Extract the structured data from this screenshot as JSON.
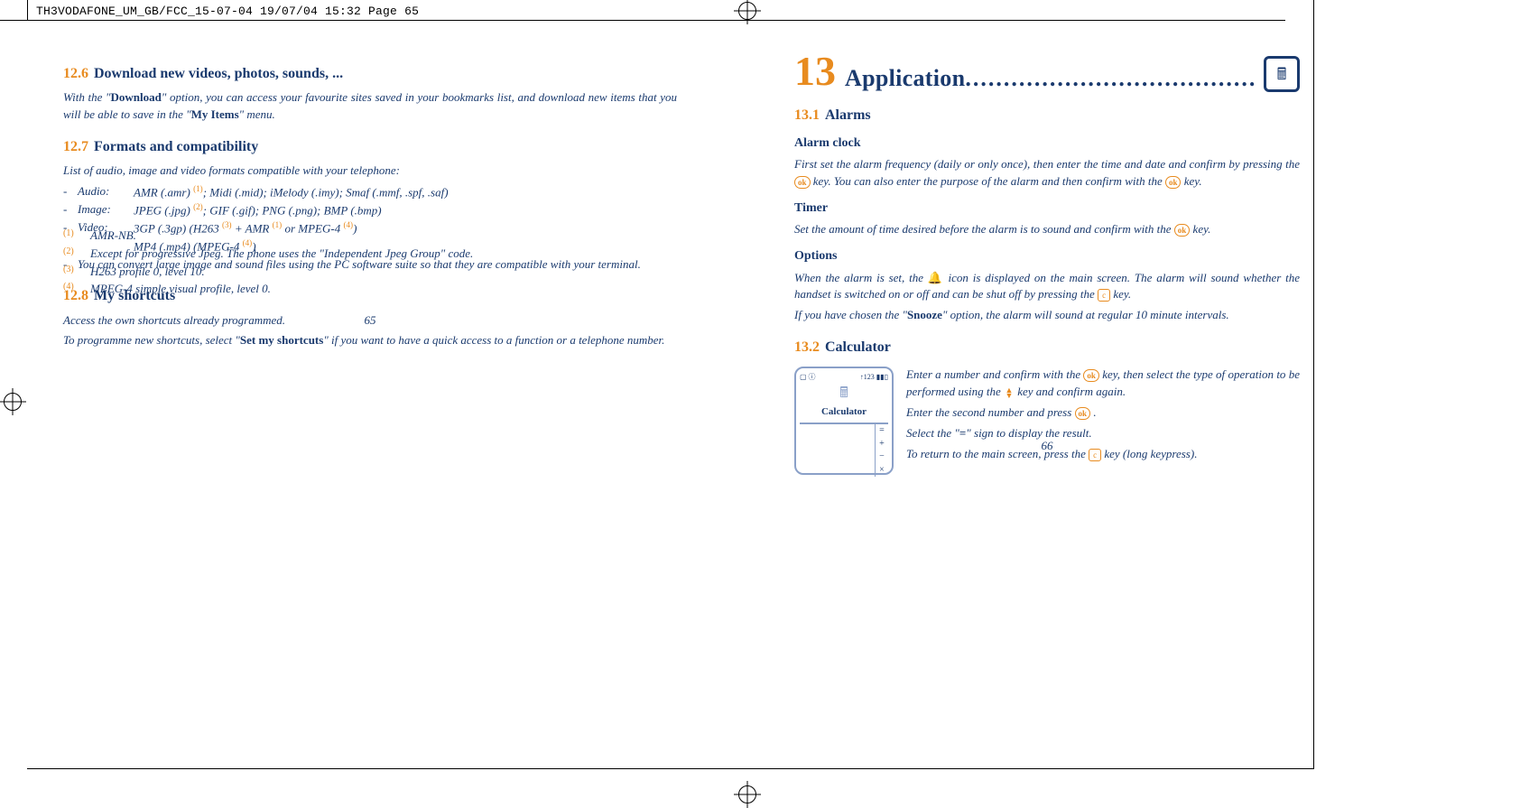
{
  "crop_header": "TH3VODAFONE_UM_GB/FCC_15-07-04  19/07/04  15:32  Page 65",
  "left": {
    "s1": {
      "num": "12.6",
      "title": "Download new videos, photos, sounds, ..."
    },
    "s1_p_a": "With the \"",
    "s1_p_b": "Download",
    "s1_p_c": "\" option, you can access your favourite sites saved in your bookmarks list, and download new items that you will be able to save in the \"",
    "s1_p_d": "My Items",
    "s1_p_e": "\" menu.",
    "s2": {
      "num": "12.7",
      "title": "Formats and compatibility"
    },
    "s2_intro": "List of audio, image and video formats compatible with your telephone:",
    "fmt": {
      "audio_lbl": "Audio:",
      "audio_val": "AMR (.amr) (1); Midi (.mid); iMelody (.imy); Smaf (.mmf, .spf, .saf)",
      "image_lbl": "Image:",
      "image_val": "JPEG (.jpg) (2); GIF (.gif); PNG (.png); BMP (.bmp)",
      "video_lbl": "Video:",
      "video_val": "3GP (.3gp) (H263 (3) + AMR (1) or MPEG-4 (4))",
      "video_val2": "MP4 (.mp4) (MPEG-4 (4))"
    },
    "s2_note": "You can convert large image and sound files using the PC software suite so that they are compatible with your terminal.",
    "s3": {
      "num": "12.8",
      "title": "My shortcuts"
    },
    "s3_p1": "Access the own shortcuts already programmed.",
    "s3_p2a": "To programme new shortcuts, select \"",
    "s3_p2b": "Set my shortcuts",
    "s3_p2c": "\" if you want to have a quick access to a function or a telephone number.",
    "fn1": "AMR-NB.",
    "fn2": "Except for progressive Jpeg. The phone uses the \"Independent Jpeg Group\" code.",
    "fn3": "H263 profile 0, level 10.",
    "fn4": "MPEG-4 simple visual profile, level 0.",
    "page_num": "65"
  },
  "right": {
    "chap_num": "13",
    "chap_title": "Application",
    "chap_dots": "............................................",
    "s1": {
      "num": "13.1",
      "title": "Alarms"
    },
    "h_alarmclock": "Alarm clock",
    "alarm_p_a": "First set the alarm frequency (daily or only once), then enter the time and date and confirm by pressing the ",
    "alarm_p_b": " key. You can also enter the purpose of the alarm and then confirm with the ",
    "alarm_p_c": " key.",
    "h_timer": "Timer",
    "timer_p_a": "Set the amount of time desired before the alarm is to sound and confirm with the ",
    "timer_p_b": " key.",
    "h_options": "Options",
    "opt_p1_a": "When the alarm is set, the ",
    "opt_p1_b": " icon is displayed on the main screen. The alarm will sound whether the handset is switched on or off and can be shut off by pressing the ",
    "opt_p1_c": " key.",
    "opt_p2_a": "If you have chosen the \"",
    "opt_p2_b": "Snooze",
    "opt_p2_c": "\" option, the alarm will sound at regular 10 minute intervals.",
    "s2": {
      "num": "13.2",
      "title": "Calculator"
    },
    "calc": {
      "status_left": "▢ ⓘ",
      "status_right": "↑123 ▮▮▯",
      "label": "Calculator",
      "ops": [
        "=",
        "+",
        "−",
        "×",
        "/",
        "."
      ]
    },
    "calc_p1_a": "Enter a number and confirm with the ",
    "calc_p1_b": " key, then select the type of operation to be performed using the ",
    "calc_p1_c": " key and confirm again.",
    "calc_p2_a": "Enter the second number and press ",
    "calc_p2_b": " .",
    "calc_p3_a": "Select the \"",
    "calc_p3_b": "=",
    "calc_p3_c": "\" sign to display the result.",
    "calc_p4_a": "To return to the main screen, press the ",
    "calc_p4_b": " key (long keypress).",
    "page_num": "66"
  },
  "icons": {
    "ok": "ok",
    "c": "c",
    "bell": "🔔",
    "up": "▲",
    "down": "▼"
  }
}
